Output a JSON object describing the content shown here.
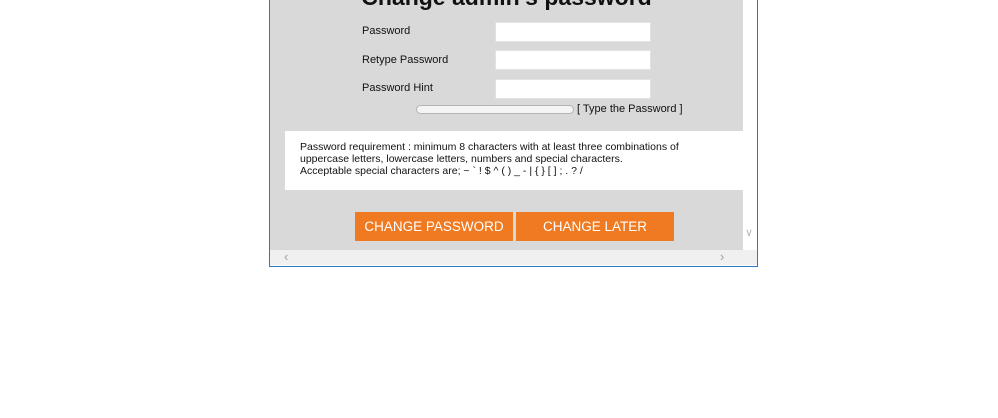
{
  "dialog": {
    "title": "Change admin's password"
  },
  "form": {
    "password_label": "Password",
    "password_value": "",
    "retype_label": "Retype Password",
    "retype_value": "",
    "hint_label": "Password Hint",
    "hint_value": "",
    "strength_text": "[ Type the Password ]"
  },
  "requirements": {
    "line1": "Password requirement : minimum 8 characters with at least three combinations of",
    "line2": "uppercase letters, lowercase letters, numbers and special characters.",
    "line3": "Acceptable special characters are; ~ ` ! $ ^ ( ) _ - | { } [ ] ; . ? /"
  },
  "buttons": {
    "change_password": "CHANGE PASSWORD",
    "change_later": "CHANGE LATER"
  },
  "colors": {
    "accent": "#f07a22",
    "panel_bg": "#d9d9d9",
    "window_border": "#2b78c2"
  },
  "icons": {
    "scroll_down": "chevron-down-icon",
    "scroll_left": "chevron-left-icon",
    "scroll_right": "chevron-right-icon"
  }
}
